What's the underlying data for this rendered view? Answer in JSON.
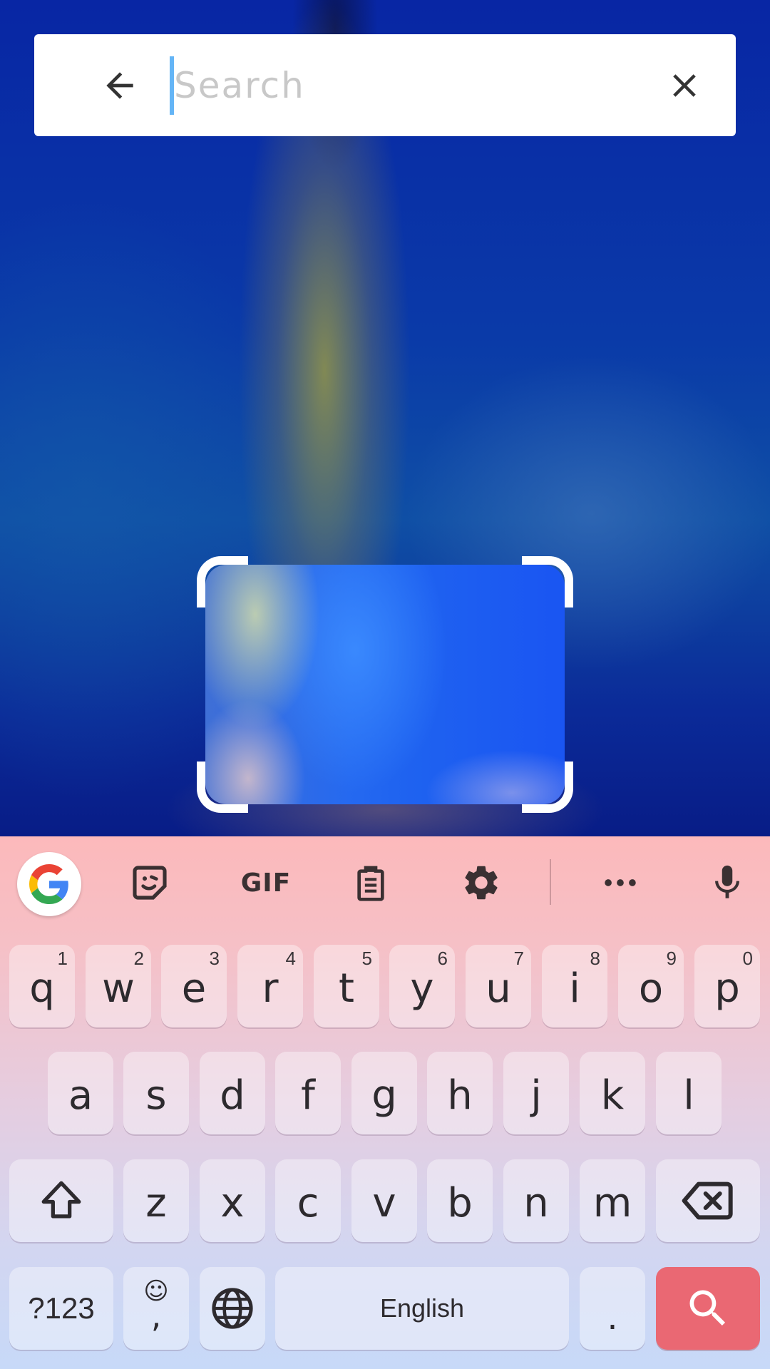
{
  "search": {
    "placeholder": "Search",
    "value": "",
    "back_icon": "arrow-back-icon",
    "clear_icon": "close-icon"
  },
  "crop_frame": {
    "icon": "image-crop-frame"
  },
  "keyboard": {
    "toolbar": {
      "items": [
        "google-icon",
        "sticker-icon",
        "GIF",
        "clipboard-icon",
        "settings-icon",
        "more-icon",
        "mic-icon"
      ],
      "gif_label": "GIF"
    },
    "row1": [
      {
        "key": "q",
        "hint": "1"
      },
      {
        "key": "w",
        "hint": "2"
      },
      {
        "key": "e",
        "hint": "3"
      },
      {
        "key": "r",
        "hint": "4"
      },
      {
        "key": "t",
        "hint": "5"
      },
      {
        "key": "y",
        "hint": "6"
      },
      {
        "key": "u",
        "hint": "7"
      },
      {
        "key": "i",
        "hint": "8"
      },
      {
        "key": "o",
        "hint": "9"
      },
      {
        "key": "p",
        "hint": "0"
      }
    ],
    "row2": [
      "a",
      "s",
      "d",
      "f",
      "g",
      "h",
      "j",
      "k",
      "l"
    ],
    "row3": [
      "z",
      "x",
      "c",
      "v",
      "b",
      "n",
      "m"
    ],
    "bottom": {
      "symbols": "?123",
      "emoji": "☺",
      "comma": ",",
      "space": "English",
      "period": "."
    },
    "colors": {
      "enter": "#ea6873",
      "accent": "#64b5f6"
    }
  }
}
